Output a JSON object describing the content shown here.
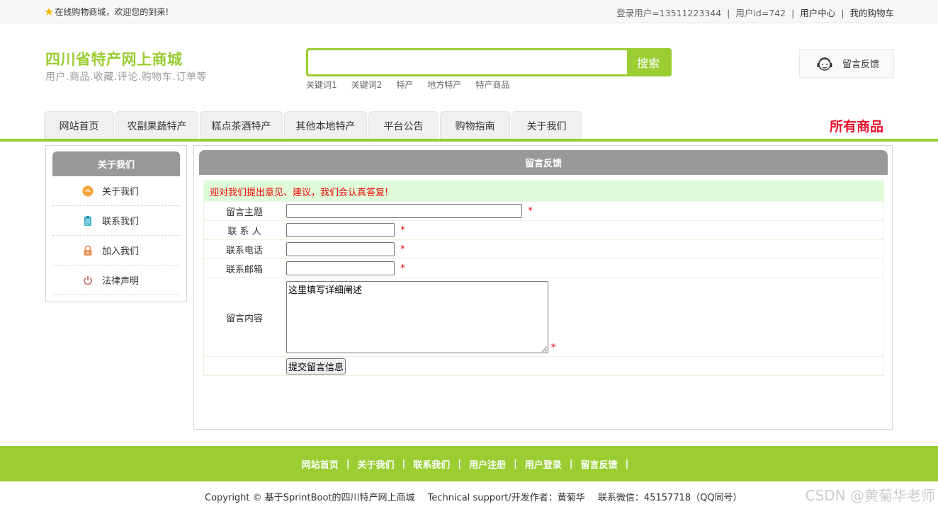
{
  "topbar": {
    "welcome": "在线购物商城，欢迎您的到来!",
    "login_user": "登录用户=13511223344",
    "user_id": "用户id=742",
    "user_center": "用户中心",
    "my_cart": "我的购物车",
    "separator": "|"
  },
  "header": {
    "title": "四川省特产网上商城",
    "subtitle": "用户.商品.收藏.评论.购物车.订单等",
    "search_value": "",
    "search_button": "搜索",
    "hot_keywords": [
      "关键词1",
      "关键词2",
      "特产",
      "地方特产",
      "特产商品"
    ],
    "feedback_label": "留言反馈"
  },
  "nav": {
    "items": [
      "网站首页",
      "农副果蔬特产",
      "糕点茶酒特产",
      "其他本地特产",
      "平台公告",
      "购物指南",
      "关于我们"
    ],
    "all_products": "所有商品"
  },
  "sidebar": {
    "title": "关于我们",
    "items": [
      {
        "label": "关于我们",
        "icon": "info-circle-icon",
        "color": "#f7a23b"
      },
      {
        "label": "联系我们",
        "icon": "clipboard-icon",
        "color": "#45b7d1"
      },
      {
        "label": "加入我们",
        "icon": "lock-icon",
        "color": "#e8925a"
      },
      {
        "label": "法律声明",
        "icon": "power-icon",
        "color": "#c97c7c"
      }
    ]
  },
  "main": {
    "title": "留言反馈",
    "notice": "迎对我们提出意见、建议，我们会认真答复!",
    "fields": {
      "subject_label": "留言主题",
      "contact_label": "联 系 人",
      "phone_label": "联系电话",
      "email_label": "联系邮箱",
      "content_label": "留言内容",
      "content_value": "这里填写详细阐述",
      "required_mark": "*"
    },
    "submit_label": "提交留言信息"
  },
  "footer": {
    "links": [
      "网站首页",
      "关于我们",
      "联系我们",
      "用户注册",
      "用户登录",
      "留言反馈"
    ],
    "separator": "|",
    "copyright": "Copyright © 基于SprintBoot的四川特产网上商城",
    "support": "Technical support/开发作者：黄菊华",
    "contact": "联系微信：45157718（QQ同号）",
    "watermark": "CSDN @黄菊华老师"
  },
  "colors": {
    "brand_green": "#9acd32",
    "accent_red": "#e8112d",
    "header_gray": "#999999",
    "notice_bg": "#e0fbd8"
  }
}
